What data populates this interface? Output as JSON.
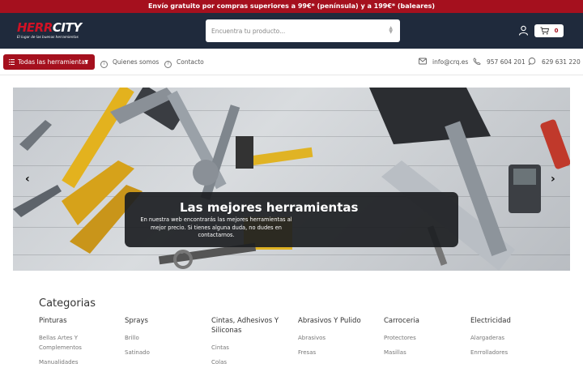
{
  "promo": {
    "text": "Envío gratuito por compras superiores a 99€* (península) y a 199€* (baleares)"
  },
  "header": {
    "logo_main_a": "HERR",
    "logo_main_b": "CITY",
    "logo_tagline": "El lugar de las buenas herramientas",
    "search_placeholder": "Encuentra tu producto...",
    "cart_count": "0"
  },
  "nav": {
    "all_tools": "Todas las herramientas",
    "links": [
      {
        "label": "Quienes somos",
        "icon": "info-icon"
      },
      {
        "label": "Contacto",
        "icon": "help-icon"
      }
    ],
    "contacts": [
      {
        "label": "info@crq.es",
        "icon": "mail-icon"
      },
      {
        "label": "957 604 201",
        "icon": "phone-icon"
      },
      {
        "label": "629 631 220",
        "icon": "chat-icon"
      }
    ]
  },
  "hero": {
    "title": "Las mejores herramientas",
    "text": "En nuestra web encontrarás las mejores herramientas al mejor precio. Si tienes alguna duda, no dudes en contactarnos.",
    "prev": "‹",
    "next": "›"
  },
  "categories": {
    "title": "Categorias",
    "columns": [
      {
        "heading": "Pinturas",
        "items": [
          "Bellas Artes Y Complementos",
          "Manualidades"
        ]
      },
      {
        "heading": "Sprays",
        "items": [
          "Brillo",
          "Satinado"
        ]
      },
      {
        "heading": "Cintas, Adhesivos Y Siliconas",
        "items": [
          "Cintas",
          "Colas"
        ]
      },
      {
        "heading": "Abrasivos Y Pulido",
        "items": [
          "Abrasivos",
          "Fresas"
        ]
      },
      {
        "heading": "Carroceria",
        "items": [
          "Protectores",
          "Masillas"
        ]
      },
      {
        "heading": "Electricidad",
        "items": [
          "Alargaderas",
          "Enrrolladores"
        ]
      }
    ]
  },
  "colors": {
    "brand_red": "#a5101e",
    "header_bg": "#1f2a3c"
  }
}
